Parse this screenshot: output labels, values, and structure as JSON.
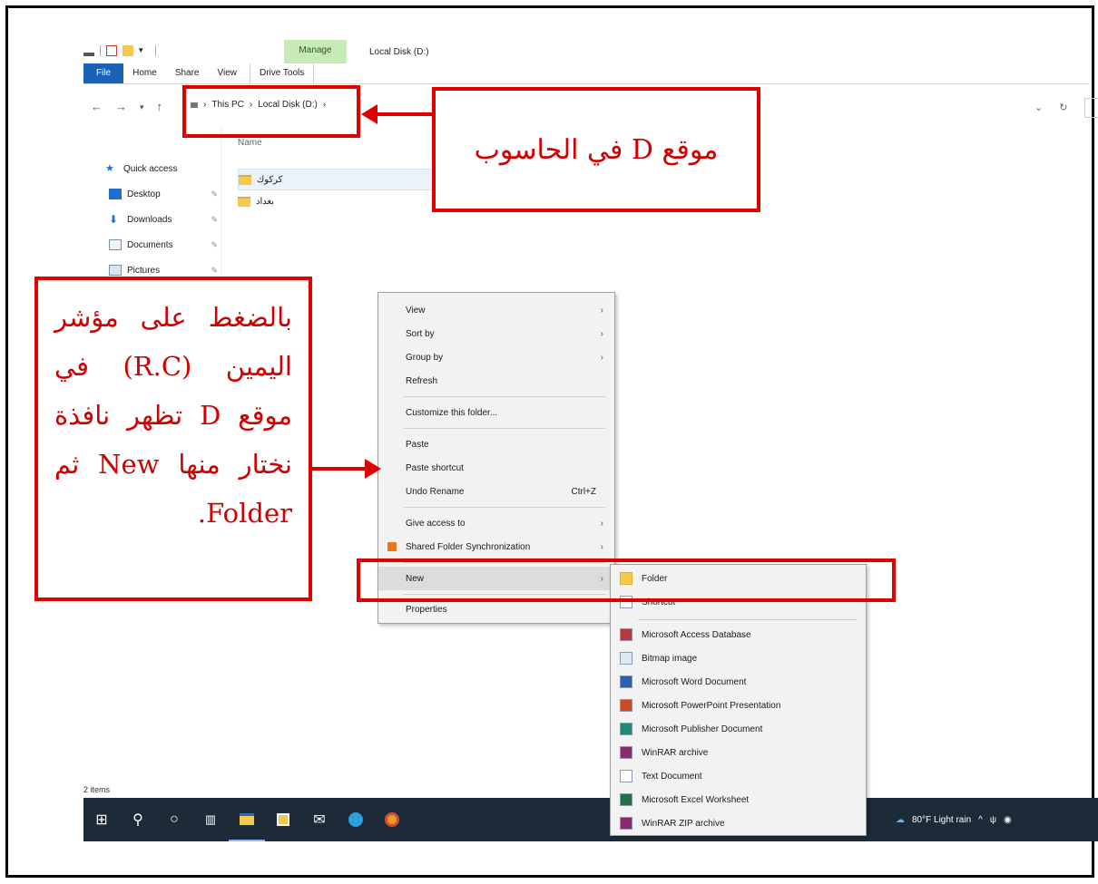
{
  "window": {
    "title": "Local Disk (D:)",
    "context_tab": "Manage"
  },
  "ribbon": {
    "tabs": [
      "File",
      "Home",
      "Share",
      "View",
      "Drive Tools"
    ]
  },
  "address_bar": {
    "crumbs": [
      "This PC",
      "Local Disk (D:)"
    ]
  },
  "column_header": "Name",
  "nav_pane": {
    "items": [
      {
        "label": "Quick access",
        "icon": "star-icon",
        "pinned": false
      },
      {
        "label": "Desktop",
        "icon": "desktop-icon",
        "pinned": true
      },
      {
        "label": "Downloads",
        "icon": "download-icon",
        "pinned": true
      },
      {
        "label": "Documents",
        "icon": "documents-icon",
        "pinned": true
      },
      {
        "label": "Pictures",
        "icon": "pictures-icon",
        "pinned": true
      }
    ]
  },
  "files": [
    {
      "name": "كركوك"
    },
    {
      "name": "بغداد"
    }
  ],
  "status_bar": "2 items",
  "context_menu": {
    "items": [
      {
        "label": "View",
        "submenu": true
      },
      {
        "label": "Sort by",
        "submenu": true
      },
      {
        "label": "Group by",
        "submenu": true
      },
      {
        "label": "Refresh"
      },
      {
        "label": "Customize this folder..."
      },
      {
        "label": "Paste"
      },
      {
        "label": "Paste shortcut"
      },
      {
        "label": "Undo Rename",
        "shortcut": "Ctrl+Z"
      },
      {
        "label": "Give access to",
        "submenu": true
      },
      {
        "label": "Shared Folder Synchronization",
        "submenu": true
      },
      {
        "label": "New",
        "submenu": true
      },
      {
        "label": "Properties"
      }
    ]
  },
  "new_submenu": {
    "items": [
      {
        "label": "Folder",
        "icon": "folder-icon"
      },
      {
        "label": "Shortcut",
        "icon": "shortcut-icon"
      },
      {
        "label": "Microsoft Access Database",
        "icon": "access-icon"
      },
      {
        "label": "Bitmap image",
        "icon": "bitmap-icon"
      },
      {
        "label": "Microsoft Word Document",
        "icon": "word-icon"
      },
      {
        "label": "Microsoft PowerPoint Presentation",
        "icon": "powerpoint-icon"
      },
      {
        "label": "Microsoft Publisher Document",
        "icon": "publisher-icon"
      },
      {
        "label": "WinRAR archive",
        "icon": "winrar-icon"
      },
      {
        "label": "Text Document",
        "icon": "text-icon"
      },
      {
        "label": "Microsoft Excel Worksheet",
        "icon": "excel-icon"
      },
      {
        "label": "WinRAR ZIP archive",
        "icon": "winrar-zip-icon"
      }
    ]
  },
  "taskbar": {
    "weather": "80°F Light rain"
  },
  "annotations": {
    "top_note": "موقع D في الحاسوب",
    "left_note": "بالضغط على مؤشر اليمين (R.C) في موقع D تظهر نافذة نختار منها New ثم Folder."
  },
  "colors": {
    "annotation_red": "#e00000",
    "file_tab": "#1a62b8",
    "manage_tab": "#c7e9b4",
    "taskbar": "#1d2a38"
  }
}
